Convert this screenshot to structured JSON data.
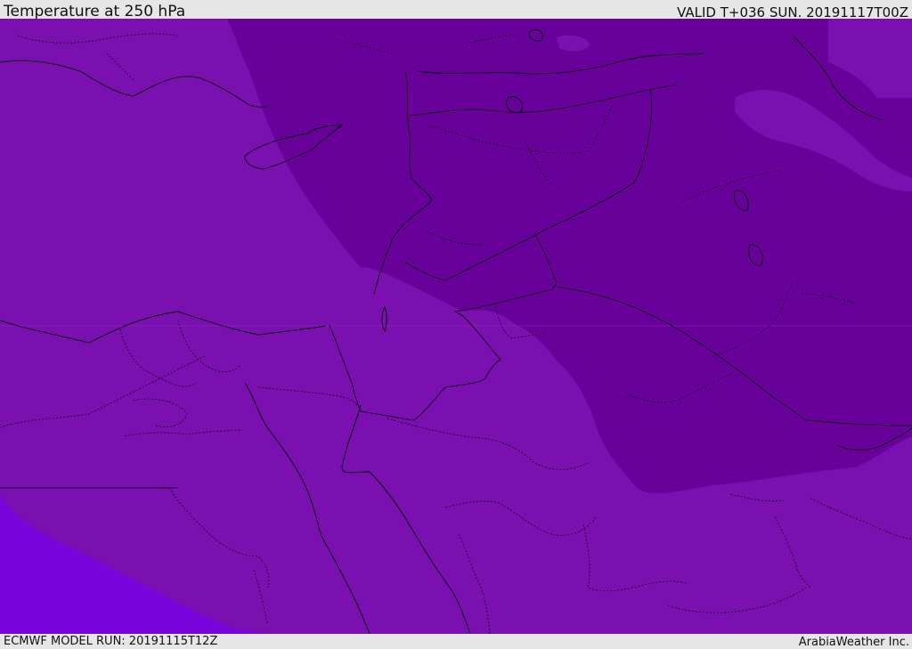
{
  "header": {
    "title": "Temperature at 250 hPa",
    "valid": "VALID T+036 SUN. 20191117T00Z"
  },
  "footer": {
    "model_run": "ECMWF MODEL RUN: 20191115T12Z",
    "credit": "ArabiaWeather Inc."
  },
  "colors": {
    "cold_band": "#670199",
    "mid_band": "#7910af",
    "warm_band": "#7a04db",
    "borders": "#000000"
  }
}
